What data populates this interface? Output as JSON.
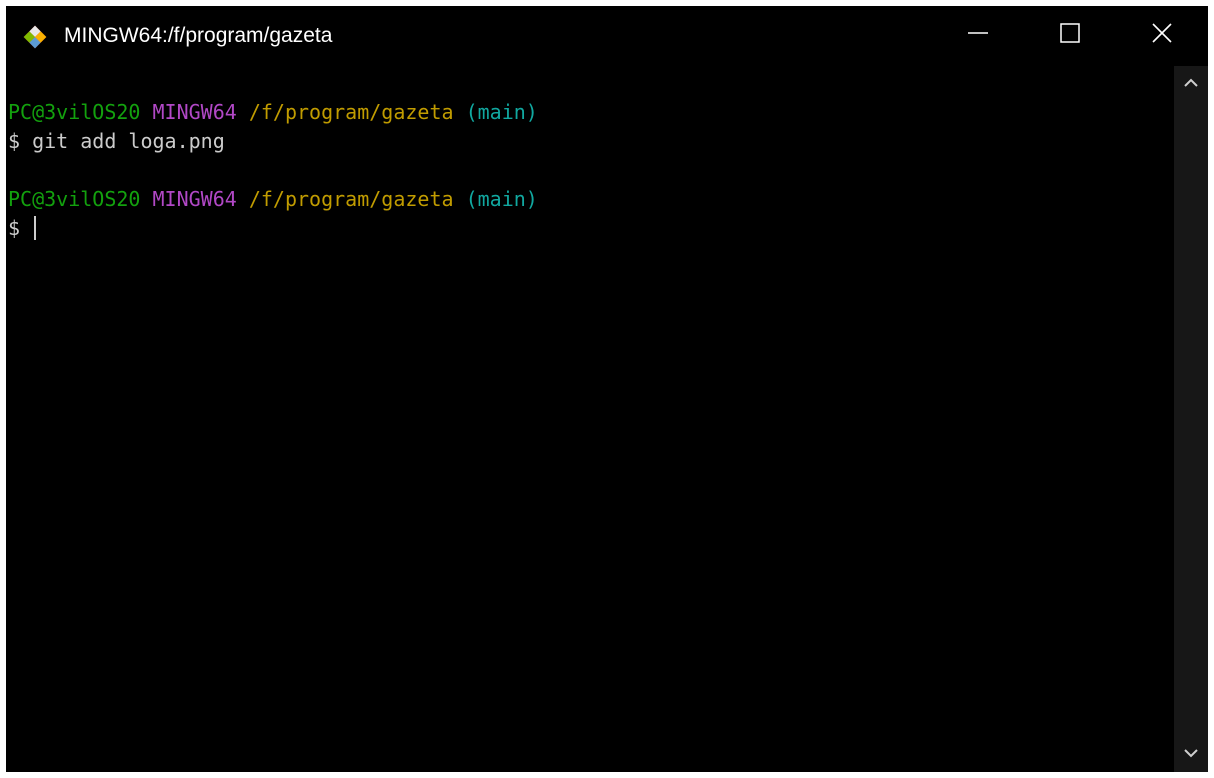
{
  "window": {
    "title": "MINGW64:/f/program/gazeta",
    "icon": "git-bash-icon",
    "controls": {
      "minimize": "minimize-icon",
      "maximize": "maximize-icon",
      "close": "close-icon"
    }
  },
  "terminal": {
    "lines": [
      {
        "user_host": "PC@3vilOS20",
        "shell": "MINGW64",
        "path": "/f/program/gazeta",
        "branch": "(main)"
      },
      {
        "prompt": "$",
        "command": "git add loga.png"
      },
      {
        "blank": ""
      },
      {
        "user_host": "PC@3vilOS20",
        "shell": "MINGW64",
        "path": "/f/program/gazeta",
        "branch": "(main)"
      },
      {
        "prompt": "$",
        "command": ""
      }
    ]
  },
  "colors": {
    "background": "#000000",
    "user_host": "#13a10e",
    "shell": "#b148c6",
    "path": "#c19c00",
    "branch": "#11a8a0",
    "text": "#cccccc",
    "scrollbar_track": "#171717"
  }
}
